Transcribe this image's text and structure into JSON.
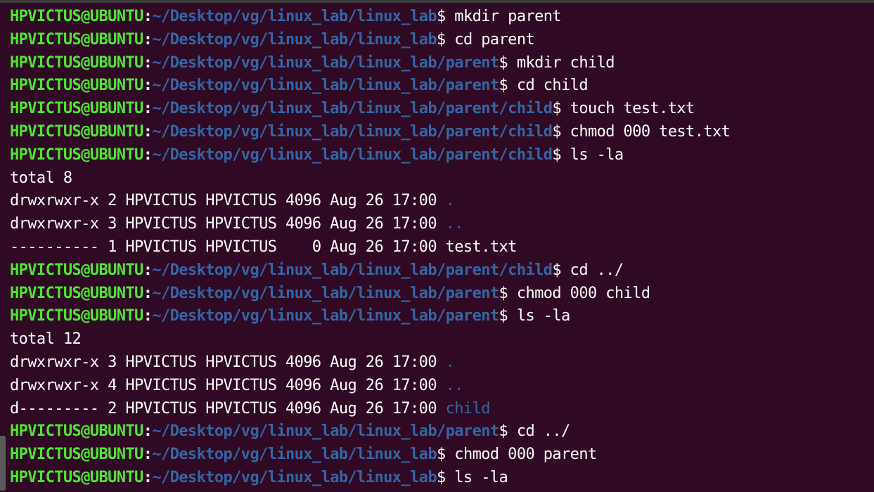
{
  "window": {
    "title": ""
  },
  "colors": {
    "background": "#300a24",
    "user": "#4ee630",
    "path": "#3465a4",
    "text": "#ffffff"
  },
  "terminal": {
    "lines": [
      {
        "kind": "prompt",
        "user": "HPVICTUS@UBUNTU",
        "sep": ":",
        "path": "~/Desktop/vg/linux_lab/linux_lab",
        "dollar": "$ ",
        "cmd": "mkdir parent"
      },
      {
        "kind": "prompt",
        "user": "HPVICTUS@UBUNTU",
        "sep": ":",
        "path": "~/Desktop/vg/linux_lab/linux_lab",
        "dollar": "$ ",
        "cmd": "cd parent"
      },
      {
        "kind": "prompt",
        "user": "HPVICTUS@UBUNTU",
        "sep": ":",
        "path": "~/Desktop/vg/linux_lab/linux_lab/parent",
        "dollar": "$ ",
        "cmd": "mkdir child"
      },
      {
        "kind": "prompt",
        "user": "HPVICTUS@UBUNTU",
        "sep": ":",
        "path": "~/Desktop/vg/linux_lab/linux_lab/parent",
        "dollar": "$ ",
        "cmd": "cd child"
      },
      {
        "kind": "prompt",
        "user": "HPVICTUS@UBUNTU",
        "sep": ":",
        "path": "~/Desktop/vg/linux_lab/linux_lab/parent/child",
        "dollar": "$ ",
        "cmd": "touch test.txt"
      },
      {
        "kind": "prompt",
        "user": "HPVICTUS@UBUNTU",
        "sep": ":",
        "path": "~/Desktop/vg/linux_lab/linux_lab/parent/child",
        "dollar": "$ ",
        "cmd": "chmod 000 test.txt"
      },
      {
        "kind": "prompt",
        "user": "HPVICTUS@UBUNTU",
        "sep": ":",
        "path": "~/Desktop/vg/linux_lab/linux_lab/parent/child",
        "dollar": "$ ",
        "cmd": "ls -la"
      },
      {
        "kind": "output",
        "text": "total 8",
        "name": ""
      },
      {
        "kind": "output",
        "text": "drwxrwxr-x 2 HPVICTUS HPVICTUS 4096 Aug 26 17:00 ",
        "name": "."
      },
      {
        "kind": "output",
        "text": "drwxrwxr-x 3 HPVICTUS HPVICTUS 4096 Aug 26 17:00 ",
        "name": ".."
      },
      {
        "kind": "output",
        "text": "---------- 1 HPVICTUS HPVICTUS    0 Aug 26 17:00 test.txt",
        "name": ""
      },
      {
        "kind": "prompt",
        "user": "HPVICTUS@UBUNTU",
        "sep": ":",
        "path": "~/Desktop/vg/linux_lab/linux_lab/parent/child",
        "dollar": "$ ",
        "cmd": "cd ../"
      },
      {
        "kind": "prompt",
        "user": "HPVICTUS@UBUNTU",
        "sep": ":",
        "path": "~/Desktop/vg/linux_lab/linux_lab/parent",
        "dollar": "$ ",
        "cmd": "chmod 000 child"
      },
      {
        "kind": "prompt",
        "user": "HPVICTUS@UBUNTU",
        "sep": ":",
        "path": "~/Desktop/vg/linux_lab/linux_lab/parent",
        "dollar": "$ ",
        "cmd": "ls -la"
      },
      {
        "kind": "output",
        "text": "total 12",
        "name": ""
      },
      {
        "kind": "output",
        "text": "drwxrwxr-x 3 HPVICTUS HPVICTUS 4096 Aug 26 17:00 ",
        "name": "."
      },
      {
        "kind": "output",
        "text": "drwxrwxr-x 4 HPVICTUS HPVICTUS 4096 Aug 26 17:00 ",
        "name": ".."
      },
      {
        "kind": "output",
        "text": "d--------- 2 HPVICTUS HPVICTUS 4096 Aug 26 17:00 ",
        "name": "child"
      },
      {
        "kind": "prompt",
        "user": "HPVICTUS@UBUNTU",
        "sep": ":",
        "path": "~/Desktop/vg/linux_lab/linux_lab/parent",
        "dollar": "$ ",
        "cmd": "cd ../"
      },
      {
        "kind": "prompt",
        "user": "HPVICTUS@UBUNTU",
        "sep": ":",
        "path": "~/Desktop/vg/linux_lab/linux_lab",
        "dollar": "$ ",
        "cmd": "chmod 000 parent"
      },
      {
        "kind": "prompt",
        "user": "HPVICTUS@UBUNTU",
        "sep": ":",
        "path": "~/Desktop/vg/linux_lab/linux_lab",
        "dollar": "$ ",
        "cmd": "ls -la"
      }
    ]
  }
}
